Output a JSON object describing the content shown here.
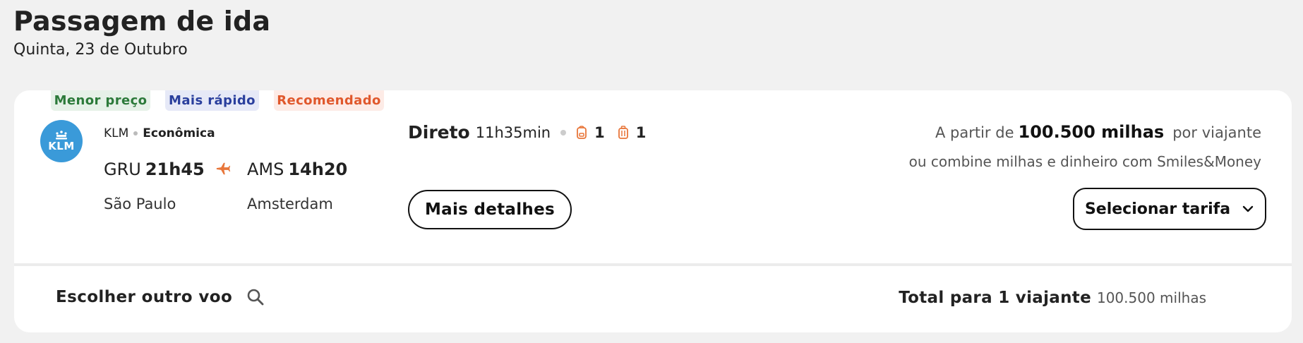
{
  "header": {
    "title": "Passagem de ida",
    "date": "Quinta, 23 de Outubro"
  },
  "tags": {
    "cheapest": "Menor preço",
    "fastest": "Mais rápido",
    "recommended": "Recomendado"
  },
  "flight": {
    "airline_logo_text": "KLM",
    "airline": "KLM",
    "cabin": "Econômica",
    "origin_code": "GRU",
    "departure_time": "21h45",
    "destination_code": "AMS",
    "arrival_time": "14h20",
    "origin_city": "São Paulo",
    "destination_city": "Amsterdam",
    "stops_label": "Direto",
    "duration": "11h35min",
    "carry_on_count": "1",
    "checked_bag_count": "1",
    "details_button": "Mais detalhes"
  },
  "pricing": {
    "from_label": "A partir de",
    "miles": "100.500 milhas",
    "per_traveler": "por viajante",
    "combine_note": "ou combine milhas e dinheiro com Smiles&Money",
    "select_fare_button": "Selecionar tarifa"
  },
  "footer": {
    "choose_other": "Escolher outro voo",
    "total_label": "Total para 1 viajante",
    "total_amount": "100.500 milhas"
  },
  "icons": {
    "plane": "plane-icon",
    "carry_on": "backpack-icon",
    "checked_bag": "suitcase-icon",
    "chevron": "chevron-down-icon",
    "search": "search-icon"
  },
  "colors": {
    "accent": "#e8763a",
    "klm_blue": "#3a9ad9",
    "tag_green_text": "#2c7a3a",
    "tag_blue_text": "#2a3f9d",
    "tag_orange_text": "#e0582c"
  }
}
